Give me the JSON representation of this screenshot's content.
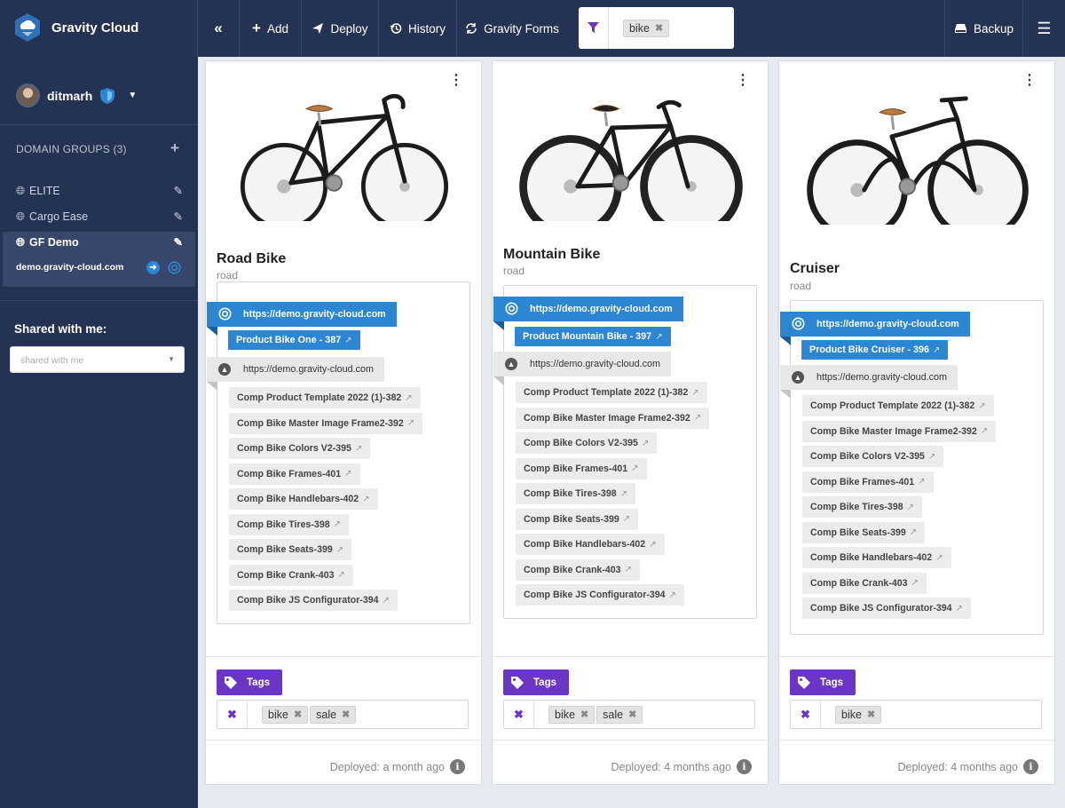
{
  "app": {
    "name": "Gravity Cloud"
  },
  "toolbar": {
    "collapse_label": "«",
    "add_label": "Add",
    "deploy_label": "Deploy",
    "history_label": "History",
    "gravity_forms_label": "Gravity Forms",
    "filter_chip": "bike",
    "backup_label": "Backup"
  },
  "sidebar": {
    "user": "ditmarh",
    "groups_header": "DOMAIN GROUPS (3)",
    "groups": [
      {
        "label": "ELITE"
      },
      {
        "label": "Cargo Ease"
      },
      {
        "label": "GF Demo"
      }
    ],
    "active_domain": "demo.gravity-cloud.com",
    "shared_header": "Shared with me:",
    "shared_placeholder": "shared with me"
  },
  "cards": [
    {
      "title": "Road Bike",
      "subtitle": "road",
      "primary_url": "https://demo.gravity-cloud.com",
      "product": "Product Bike One - 387",
      "secondary_url": "https://demo.gravity-cloud.com",
      "comps": [
        "Comp Product Template 2022 (1)-382",
        "Comp Bike Master Image Frame2-392",
        "Comp Bike Colors V2-395",
        "Comp Bike Frames-401",
        "Comp Bike Handlebars-402",
        "Comp Bike Tires-398",
        "Comp Bike Seats-399",
        "Comp Bike Crank-403",
        "Comp Bike JS Configurator-394"
      ],
      "tags_label": "Tags",
      "tags": [
        "bike",
        "sale"
      ],
      "deployed": "Deployed: a month ago"
    },
    {
      "title": "Mountain Bike",
      "subtitle": "road",
      "primary_url": "https://demo.gravity-cloud.com",
      "product": "Product Mountain Bike - 397",
      "secondary_url": "https://demo.gravity-cloud.com",
      "comps": [
        "Comp Product Template 2022 (1)-382",
        "Comp Bike Master Image Frame2-392",
        "Comp Bike Colors V2-395",
        "Comp Bike Frames-401",
        "Comp Bike Tires-398",
        "Comp Bike Seats-399",
        "Comp Bike Handlebars-402",
        "Comp Bike Crank-403",
        "Comp Bike JS Configurator-394"
      ],
      "tags_label": "Tags",
      "tags": [
        "bike",
        "sale"
      ],
      "deployed": "Deployed: 4 months ago"
    },
    {
      "title": "Cruiser",
      "subtitle": "road",
      "primary_url": "https://demo.gravity-cloud.com",
      "product": "Product Bike Cruiser - 396",
      "secondary_url": "https://demo.gravity-cloud.com",
      "comps": [
        "Comp Product Template 2022 (1)-382",
        "Comp Bike Master Image Frame2-392",
        "Comp Bike Colors V2-395",
        "Comp Bike Frames-401",
        "Comp Bike Tires-398",
        "Comp Bike Seats-399",
        "Comp Bike Handlebars-402",
        "Comp Bike Crank-403",
        "Comp Bike JS Configurator-394"
      ],
      "tags_label": "Tags",
      "tags": [
        "bike"
      ],
      "deployed": "Deployed: 4 months ago"
    }
  ],
  "colors": {
    "nav": "#243353",
    "accent_blue": "#2c86d1",
    "tags_purple": "#6b35c8"
  }
}
